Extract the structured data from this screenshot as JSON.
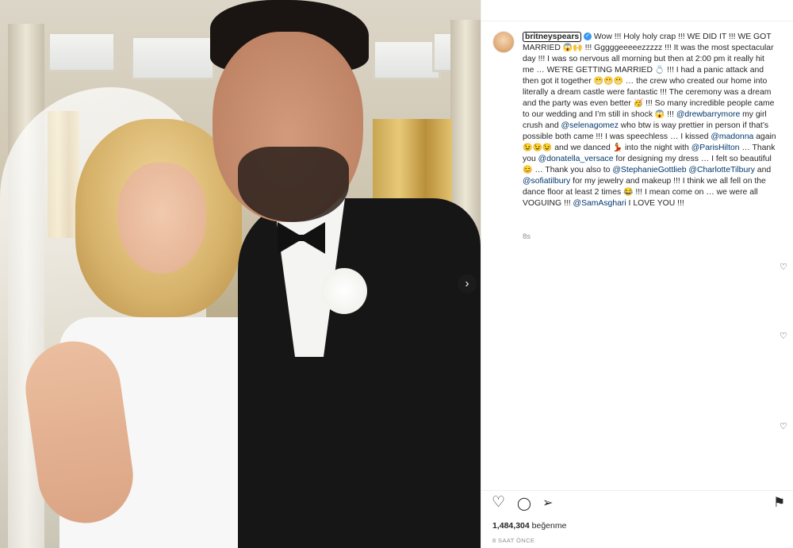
{
  "post": {
    "username": "britneyspears",
    "verified_mark": "✓",
    "caption_segments": [
      {
        "type": "text",
        "value": " Wow !!! Holy holy crap !!! WE DID IT !!! WE GOT MARRIED "
      },
      {
        "type": "emoji",
        "value": "😱🙌"
      },
      {
        "type": "text",
        "value": " !!! Gggggeeeeezzzzz !!! It was the most spectacular day !!! I was so nervous all morning but then at 2:00 pm it really hit me … WE’RE GETTING MARRIED "
      },
      {
        "type": "emoji",
        "value": "💍"
      },
      {
        "type": "text",
        "value": " !!! I had a panic attack and then got it together "
      },
      {
        "type": "emoji",
        "value": "😬😬😬"
      },
      {
        "type": "text",
        "value": " … the crew who created our home into literally a dream castle were fantastic !!! The ceremony was a dream and the party was even better "
      },
      {
        "type": "emoji",
        "value": "🥳"
      },
      {
        "type": "text",
        "value": " !!! So many incredible people came to our wedding and I’m still in shock "
      },
      {
        "type": "emoji",
        "value": "😱"
      },
      {
        "type": "text",
        "value": " !!! "
      },
      {
        "type": "mention",
        "value": "@drewbarrymore"
      },
      {
        "type": "text",
        "value": " my girl crush and "
      },
      {
        "type": "mention",
        "value": "@selenagomez"
      },
      {
        "type": "text",
        "value": " who btw is way prettier in person if that’s possible both came !!! I was speechless … I kissed "
      },
      {
        "type": "mention",
        "value": "@madonna"
      },
      {
        "type": "text",
        "value": " again "
      },
      {
        "type": "emoji",
        "value": "😉😉😉"
      },
      {
        "type": "text",
        "value": " and we danced "
      },
      {
        "type": "emoji",
        "value": "💃"
      },
      {
        "type": "text",
        "value": " into the night with "
      },
      {
        "type": "mention",
        "value": "@ParisHilton"
      },
      {
        "type": "text",
        "value": " … Thank you "
      },
      {
        "type": "mention",
        "value": "@donatella_versace"
      },
      {
        "type": "text",
        "value": " for designing my dress … I felt so beautiful "
      },
      {
        "type": "emoji",
        "value": "😊"
      },
      {
        "type": "text",
        "value": " … Thank you also to "
      },
      {
        "type": "mention",
        "value": "@StephanieGottlieb"
      },
      {
        "type": "text",
        "value": " "
      },
      {
        "type": "mention",
        "value": "@CharlotteTilbury"
      },
      {
        "type": "text",
        "value": " and "
      },
      {
        "type": "mention",
        "value": "@sofiatilbury"
      },
      {
        "type": "text",
        "value": " for my jewelry and makeup !!! I think we all fell on the dance floor at least 2 times "
      },
      {
        "type": "emoji",
        "value": "😂"
      },
      {
        "type": "text",
        "value": " !!! I mean come on … we were all VOGUING !!! "
      },
      {
        "type": "mention",
        "value": "@SamAsghari"
      },
      {
        "type": "text",
        "value": " I LOVE YOU !!!"
      }
    ],
    "caption_timestamp": "8s",
    "likes_count": "1,484,304",
    "likes_word": "beğenme",
    "time_ago": "8 SAAT ÖNCE"
  },
  "icons": {
    "carousel_next": "›",
    "heart": "♡",
    "comment": "◯",
    "share": "➢",
    "save": "⚑",
    "reply_heart": "♡"
  },
  "colors": {
    "mention": "#00376b",
    "verified": "#3897f0",
    "muted": "#8e8e8e"
  }
}
